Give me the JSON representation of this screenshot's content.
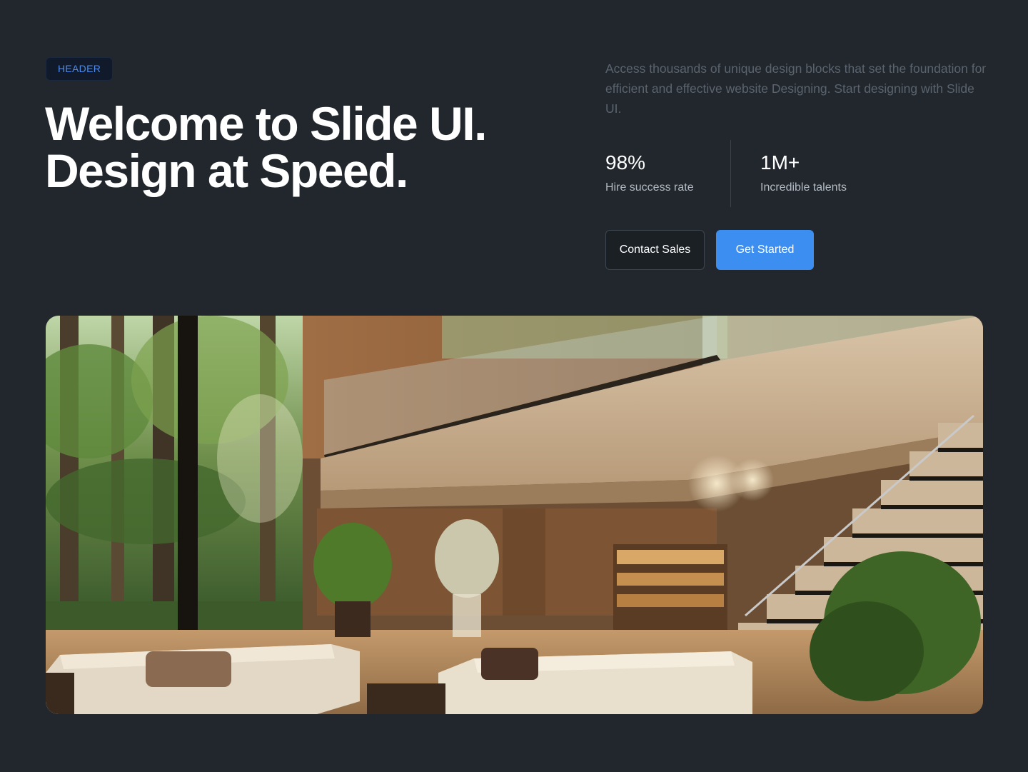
{
  "header": {
    "badge": "HEADER",
    "headline_line1": "Welcome to Slide UI.",
    "headline_line2": "Design at Speed."
  },
  "intro": {
    "description": "Access thousands of unique design blocks that set the foundation for efficient and effective website Designing. Start designing with Slide UI."
  },
  "stats": [
    {
      "value": "98%",
      "label": "Hire success rate"
    },
    {
      "value": "1M+",
      "label": "Incredible talents"
    }
  ],
  "actions": {
    "secondary_label": "Contact Sales",
    "primary_label": "Get Started"
  },
  "hero_image": {
    "subject": "modern living room interior with wooden walls, staircase and forest view"
  },
  "colors": {
    "background": "#21272d",
    "accent": "#3c8ef0",
    "badge_text": "#4f8be6",
    "muted_text": "#5b646e"
  }
}
